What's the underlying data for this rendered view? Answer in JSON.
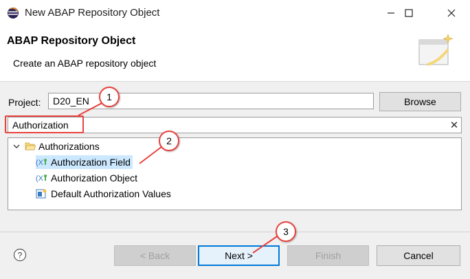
{
  "window": {
    "title": "New ABAP Repository Object",
    "icon": "eclipse-icon",
    "controls": [
      "minimize-icon",
      "maximize-icon",
      "close-icon"
    ]
  },
  "banner": {
    "title": "ABAP Repository Object",
    "subtitle": "Create an ABAP repository object",
    "image": "wizard-banner-icon"
  },
  "project": {
    "label": "Project:",
    "value": "D20_EN",
    "browse_label": "Browse"
  },
  "filter": {
    "value": "Authorization",
    "clear_icon": "clear-icon"
  },
  "tree": {
    "root": {
      "label": "Authorizations",
      "expanded": true,
      "icon": "folder-icon"
    },
    "items": [
      {
        "label": "Authorization Field",
        "selected": true,
        "icon": "authorization-field-icon"
      },
      {
        "label": "Authorization Object",
        "selected": false,
        "icon": "authorization-object-icon"
      },
      {
        "label": "Default Authorization Values",
        "selected": false,
        "icon": "default-values-icon"
      }
    ]
  },
  "footer": {
    "help_icon": "help-icon",
    "back_label": "< Back",
    "next_label": "Next >",
    "finish_label": "Finish",
    "cancel_label": "Cancel"
  },
  "callouts": {
    "one": "1",
    "two": "2",
    "three": "3",
    "color": "#e8413c"
  },
  "colors": {
    "selection": "#cce8ff",
    "accent": "#0078d7",
    "dialog_bg": "#f0f0f0"
  }
}
